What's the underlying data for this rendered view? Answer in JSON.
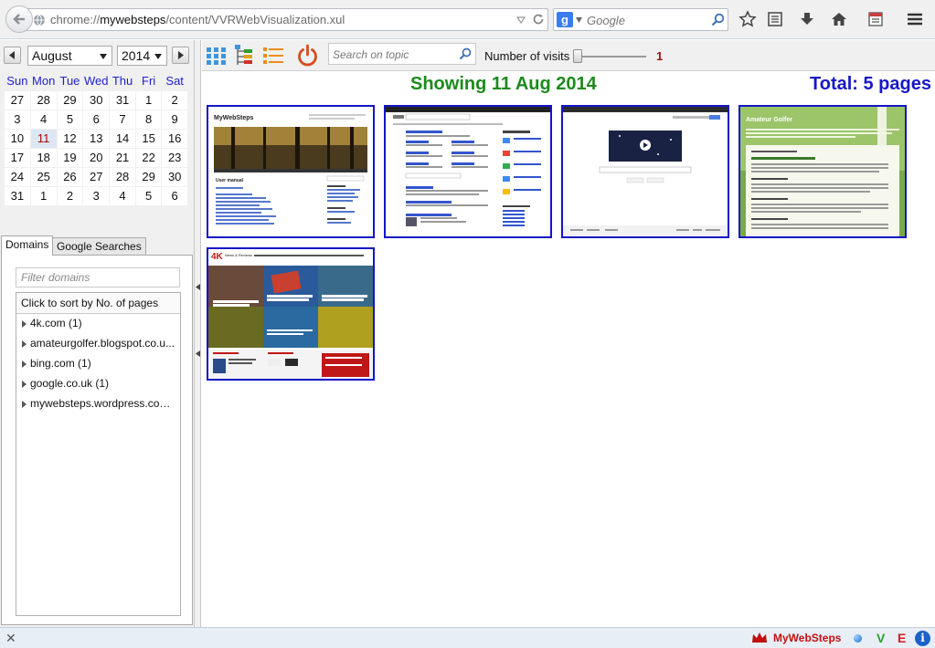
{
  "browser": {
    "url_prefix": "chrome://",
    "url_host": "mywebsteps",
    "url_path": "/content/VVRWebVisualization.xul",
    "search_engine_letter": "g",
    "search_placeholder": "Google"
  },
  "calendar": {
    "month": "August",
    "year": "2014",
    "day_headers": [
      "Sun",
      "Mon",
      "Tue",
      "Wed",
      "Thu",
      "Fri",
      "Sat"
    ],
    "weeks": [
      [
        "27",
        "28",
        "29",
        "30",
        "31",
        "1",
        "2"
      ],
      [
        "3",
        "4",
        "5",
        "6",
        "7",
        "8",
        "9"
      ],
      [
        "10",
        "11",
        "12",
        "13",
        "14",
        "15",
        "16"
      ],
      [
        "17",
        "18",
        "19",
        "20",
        "21",
        "22",
        "23"
      ],
      [
        "24",
        "25",
        "26",
        "27",
        "28",
        "29",
        "30"
      ],
      [
        "31",
        "1",
        "2",
        "3",
        "4",
        "5",
        "6"
      ]
    ],
    "selected_day": "11"
  },
  "tabs": {
    "domains": "Domains",
    "google_searches": "Google Searches"
  },
  "domains_panel": {
    "filter_placeholder": "Filter domains",
    "sort_header": "Click to sort by No. of pages",
    "items": [
      "4k.com (1)",
      "amateurgolfer.blogspot.co.u...",
      "bing.com (1)",
      "google.co.uk (1)",
      "mywebsteps.wordpress.com ..."
    ]
  },
  "toolbar": {
    "topic_placeholder": "Search on topic",
    "visits_label": "Number of visits",
    "visits_value": "1"
  },
  "heading": {
    "showing": "Showing 11 Aug 2014",
    "total": "Total: 5 pages"
  },
  "thumbnails": {
    "mywebsteps_title": "MyWebSteps",
    "mywebsteps_section": "User manual",
    "golfer_title": "Amateur Golfer",
    "fourk_title": "4K",
    "fourk_subtitle": "News & Reviews"
  },
  "statusbar": {
    "brand": "MyWebSteps",
    "v_label": "V",
    "e_label": "E",
    "info_label": "i",
    "close_label": "✕"
  },
  "colors": {
    "thumb_border": "#1414c8",
    "showing": "#1c8a1c",
    "total": "#1717c8",
    "visits_value": "#9b1010"
  }
}
